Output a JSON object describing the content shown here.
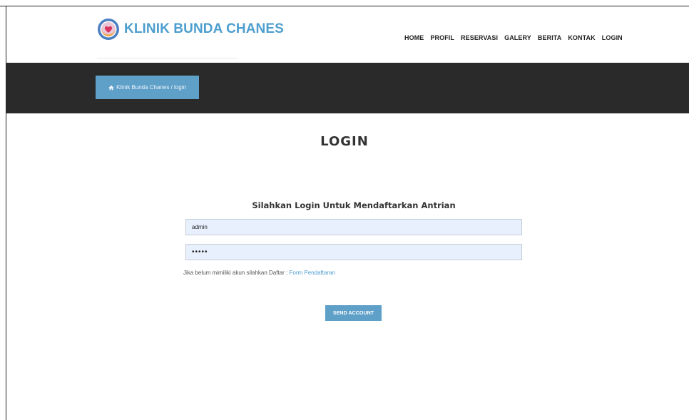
{
  "brand": {
    "name": "KLINIK BUNDA CHANES",
    "logo_icon": "heart-hands-logo-icon"
  },
  "nav": {
    "items": [
      "HOME",
      "PROFIL",
      "RESERVASI",
      "GALERY",
      "BERITA",
      "KONTAK",
      "LOGIN"
    ]
  },
  "breadcrumb": {
    "text": "Klinik Bunda Chanes / login",
    "icon": "home-icon"
  },
  "page": {
    "title": "LOGIN",
    "subtitle": "Silahkan Login Untuk Mendaftarkan Antrian"
  },
  "form": {
    "username_value": "admin",
    "password_value": "•••••",
    "note_text": "Jika belum mimiliki akun silahkan Daftar : ",
    "register_link": "Form Pendaftaran",
    "submit_label": "SEND ACCOUNT"
  },
  "colors": {
    "accent": "#5fa0c8",
    "brand": "#4d9ecf",
    "dark_bar": "#2a2a2a",
    "input_bg": "#e8f0fe"
  }
}
